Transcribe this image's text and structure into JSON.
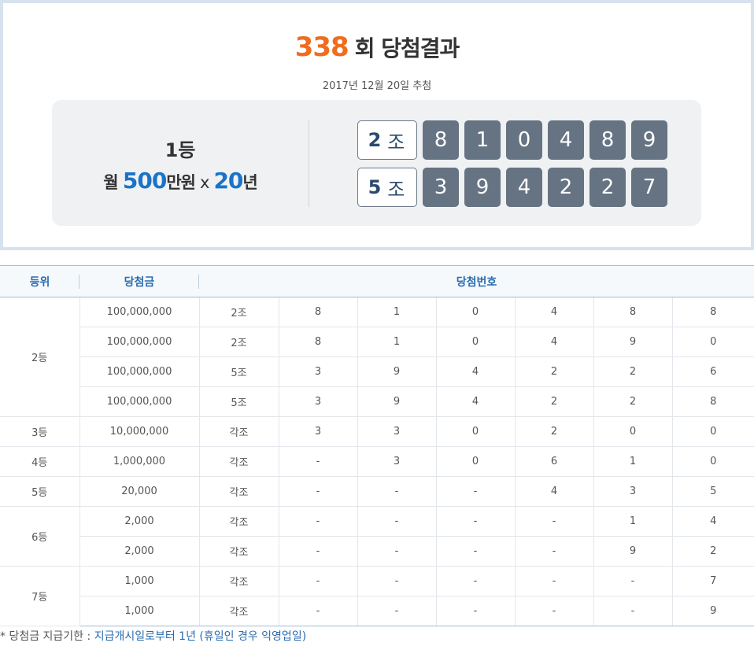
{
  "result": {
    "round_number": "338",
    "round_suffix": "회 당첨결과",
    "draw_date": "2017년 12월 20일 추첨",
    "first_prize": {
      "rank": "1등",
      "month_label": "월",
      "amount": "500",
      "amount_unit": "만원",
      "times": "x",
      "years": "20",
      "years_unit": "년"
    },
    "rows": [
      {
        "group": "2",
        "group_unit": "조",
        "numbers": [
          "8",
          "1",
          "0",
          "4",
          "8",
          "9"
        ]
      },
      {
        "group": "5",
        "group_unit": "조",
        "numbers": [
          "3",
          "9",
          "4",
          "2",
          "2",
          "7"
        ]
      }
    ]
  },
  "table": {
    "headers": {
      "rank": "등위",
      "prize": "당첨금",
      "numbers": "당첨번호"
    },
    "rows": [
      {
        "rank": "2등",
        "rowspan": 4,
        "prize": "100,000,000",
        "group": "2조",
        "nums": [
          "8",
          "1",
          "0",
          "4",
          "8",
          "8"
        ]
      },
      {
        "prize": "100,000,000",
        "group": "2조",
        "nums": [
          "8",
          "1",
          "0",
          "4",
          "9",
          "0"
        ]
      },
      {
        "prize": "100,000,000",
        "group": "5조",
        "nums": [
          "3",
          "9",
          "4",
          "2",
          "2",
          "6"
        ]
      },
      {
        "prize": "100,000,000",
        "group": "5조",
        "nums": [
          "3",
          "9",
          "4",
          "2",
          "2",
          "8"
        ]
      },
      {
        "rank": "3등",
        "rowspan": 1,
        "prize": "10,000,000",
        "group": "각조",
        "nums": [
          "3",
          "3",
          "0",
          "2",
          "0",
          "0"
        ]
      },
      {
        "rank": "4등",
        "rowspan": 1,
        "prize": "1,000,000",
        "group": "각조",
        "nums": [
          "-",
          "3",
          "0",
          "6",
          "1",
          "0"
        ]
      },
      {
        "rank": "5등",
        "rowspan": 1,
        "prize": "20,000",
        "group": "각조",
        "nums": [
          "-",
          "-",
          "-",
          "4",
          "3",
          "5"
        ]
      },
      {
        "rank": "6등",
        "rowspan": 2,
        "prize": "2,000",
        "group": "각조",
        "nums": [
          "-",
          "-",
          "-",
          "-",
          "1",
          "4"
        ]
      },
      {
        "prize": "2,000",
        "group": "각조",
        "nums": [
          "-",
          "-",
          "-",
          "-",
          "9",
          "2"
        ]
      },
      {
        "rank": "7등",
        "rowspan": 2,
        "prize": "1,000",
        "group": "각조",
        "nums": [
          "-",
          "-",
          "-",
          "-",
          "-",
          "7"
        ]
      },
      {
        "prize": "1,000",
        "group": "각조",
        "nums": [
          "-",
          "-",
          "-",
          "-",
          "-",
          "9"
        ]
      }
    ]
  },
  "footnote": {
    "label": "* 당첨금 지급기한 :",
    "value": "지급개시일로부터 1년 (휴일인 경우 익영업일)"
  }
}
